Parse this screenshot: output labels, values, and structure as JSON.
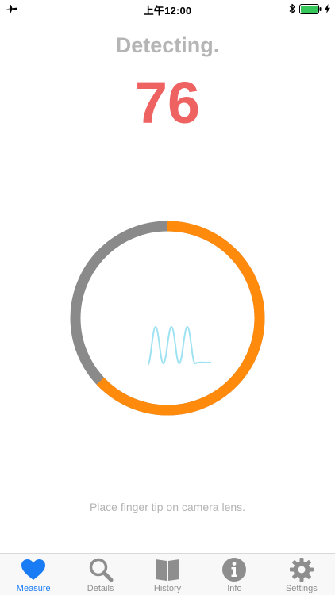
{
  "status": {
    "time": "上午12:00"
  },
  "measure": {
    "title": "Detecting.",
    "bpm": "76",
    "progress": 0.63,
    "hint": "Place finger tip on camera lens."
  },
  "colors": {
    "progress": "#ff8a0c",
    "track": "#8a8a8a",
    "pulse": "#9fe3f2",
    "bpm": "#ef6262",
    "accent": "#1a7cf5"
  },
  "tabs": [
    {
      "label": "Measure",
      "icon": "heart-icon",
      "active": true
    },
    {
      "label": "Details",
      "icon": "search-icon",
      "active": false
    },
    {
      "label": "History",
      "icon": "book-icon",
      "active": false
    },
    {
      "label": "Info",
      "icon": "info-icon",
      "active": false
    },
    {
      "label": "Settings",
      "icon": "gear-icon",
      "active": false
    }
  ]
}
